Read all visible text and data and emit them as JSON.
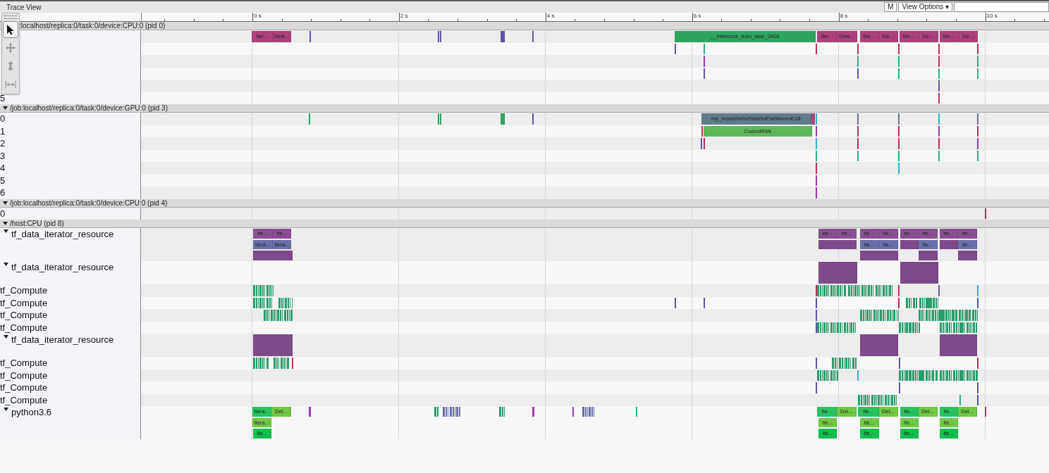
{
  "window": {
    "title": "Trace View"
  },
  "header_buttons": [
    {
      "label": "M"
    },
    {
      "label": "View Options ▾"
    }
  ],
  "tools": [
    {
      "kind": "select",
      "selected": true
    },
    {
      "kind": "pan",
      "selected": false
    },
    {
      "kind": "zoom",
      "selected": false
    },
    {
      "kind": "timing",
      "selected": false
    }
  ],
  "ruler": {
    "ticks": [
      {
        "label": "0 s"
      },
      {
        "label": "2 s"
      },
      {
        "label": "4 s"
      },
      {
        "label": "6 s"
      },
      {
        "label": "8 s"
      },
      {
        "label": "10 s"
      }
    ]
  },
  "processes": [
    {
      "title": ":localhost/replica:0/task:0/device:CPU:0 (pid 0)",
      "expanded": true,
      "under_toolbar": true,
      "threads": [
        {
          "kind": "plain",
          "lanes": [
            [
              {
                "kind": "slice",
                "color": "#ab4279",
                "label": "Iter..."
              },
              {
                "kind": "slice",
                "color": "#ab4279",
                "label": "Dele..."
              },
              {
                "kind": "tick",
                "color": "#5b57a8"
              },
              {
                "kind": "tick",
                "color": "#5b57a8"
              },
              {
                "kind": "tick",
                "color": "#5b57a8"
              },
              {
                "kind": "slice",
                "color": "#5b57a8"
              },
              {
                "kind": "tick",
                "color": "#5b57a8"
              },
              {
                "kind": "slice",
                "color": "#2ea55e",
                "label": "__inference_train_step_3406"
              },
              {
                "kind": "slice",
                "color": "#ab4279",
                "label": "Iter..."
              },
              {
                "kind": "slice",
                "color": "#ab4279",
                "label": "Dele..."
              },
              {
                "kind": "slice",
                "color": "#ab4279",
                "label": "Iter..."
              },
              {
                "kind": "slice",
                "color": "#ab4279",
                "label": "De..."
              },
              {
                "kind": "slice",
                "color": "#ab4279",
                "label": "Iter..."
              },
              {
                "kind": "slice",
                "color": "#ab4279",
                "label": "De..."
              },
              {
                "kind": "slice",
                "color": "#ab4279",
                "label": "Iter..."
              },
              {
                "kind": "slice",
                "color": "#ab4279",
                "label": "De..."
              }
            ]
          ]
        },
        {
          "kind": "plain",
          "lanes": [
            [
              {
                "kind": "tick",
                "color": "#5b57a8"
              },
              {
                "kind": "tick",
                "color": "#2bb28a"
              },
              {
                "kind": "tick",
                "color": "#c0305a"
              },
              {
                "kind": "tick",
                "color": "#c0305a"
              },
              {
                "kind": "tick",
                "color": "#c0305a"
              },
              {
                "kind": "tick",
                "color": "#c0305a"
              },
              {
                "kind": "tick",
                "color": "#c0305a"
              }
            ]
          ]
        },
        {
          "kind": "plain",
          "lanes": [
            [
              {
                "kind": "tick",
                "color": "#9b3cb0"
              },
              {
                "kind": "tick",
                "color": "#2bb28a"
              },
              {
                "kind": "tick",
                "color": "#2bb28a"
              },
              {
                "kind": "tick",
                "color": "#c0305a"
              },
              {
                "kind": "tick",
                "color": "#2bb28a"
              }
            ]
          ]
        },
        {
          "kind": "plain",
          "lanes": [
            [
              {
                "kind": "tick",
                "color": "#5b57a8"
              },
              {
                "kind": "tick",
                "color": "#5b57a8"
              },
              {
                "kind": "tick",
                "color": "#2bb28a"
              },
              {
                "kind": "tick",
                "color": "#2bb28a"
              },
              {
                "kind": "tick",
                "color": "#2bb28a"
              }
            ]
          ]
        },
        {
          "kind": "plain",
          "lanes": [
            [
              {
                "kind": "tick",
                "color": "#5b57a8"
              }
            ]
          ]
        },
        {
          "kind": "plain",
          "label": "5",
          "lanes": [
            [
              {
                "kind": "tick",
                "color": "#c0305a"
              }
            ]
          ]
        }
      ]
    },
    {
      "title": "/job:localhost/replica:0/task:0/device:GPU:0 (pid 3)",
      "expanded": true,
      "under_toolbar": false,
      "threads": [
        {
          "kind": "plain",
          "label": "0",
          "lanes": [
            [
              {
                "kind": "tick",
                "color": "#2ea55e"
              },
              {
                "kind": "tick",
                "color": "#2ea55e"
              },
              {
                "kind": "tick",
                "color": "#2ea55e"
              },
              {
                "kind": "slice",
                "color": "#2ea55e"
              },
              {
                "kind": "tick",
                "color": "#5b57a8"
              },
              {
                "kind": "slice",
                "color": "#5f7c8c",
                "label": "my_model/lstm/StatefulPartitionedCall"
              },
              {
                "kind": "slice",
                "color": "#ab4279"
              },
              {
                "kind": "tick",
                "color": "#2cb5c8"
              },
              {
                "kind": "tick",
                "color": "#5f7c8c"
              },
              {
                "kind": "tick",
                "color": "#5f7c8c"
              },
              {
                "kind": "tick",
                "color": "#2cb5c8"
              },
              {
                "kind": "tick",
                "color": "#5f7c8c"
              }
            ]
          ]
        },
        {
          "kind": "plain",
          "label": "1",
          "lanes": [
            [
              {
                "kind": "tick",
                "color": "#c0305a"
              },
              {
                "kind": "slice",
                "color": "#5db85a",
                "label": "CudnnRNN"
              },
              {
                "kind": "tick",
                "color": "#9b3cb0"
              },
              {
                "kind": "tick",
                "color": "#c0305a"
              },
              {
                "kind": "tick",
                "color": "#c0305a"
              },
              {
                "kind": "tick",
                "color": "#9b3cb0"
              },
              {
                "kind": "tick",
                "color": "#c0305a"
              }
            ]
          ]
        },
        {
          "kind": "plain",
          "label": "2",
          "lanes": [
            [
              {
                "kind": "tick",
                "color": "#5b57a8"
              },
              {
                "kind": "tick",
                "color": "#c0305a"
              },
              {
                "kind": "tick",
                "color": "#2cb5c8"
              },
              {
                "kind": "tick",
                "color": "#c0305a"
              },
              {
                "kind": "tick",
                "color": "#c0305a"
              },
              {
                "kind": "tick",
                "color": "#c0305a"
              },
              {
                "kind": "tick",
                "color": "#9b3cb0"
              }
            ]
          ]
        },
        {
          "kind": "plain",
          "label": "3",
          "lanes": [
            [
              {
                "kind": "tick",
                "color": "#2bb28a"
              },
              {
                "kind": "tick",
                "color": "#2bb28a"
              },
              {
                "kind": "tick",
                "color": "#2bb28a"
              },
              {
                "kind": "tick",
                "color": "#2bb28a"
              },
              {
                "kind": "tick",
                "color": "#2bb28a"
              }
            ]
          ]
        },
        {
          "kind": "plain",
          "label": "4",
          "lanes": [
            [
              {
                "kind": "tick",
                "color": "#c0305a"
              },
              {
                "kind": "tick",
                "color": "#2cb5c8"
              }
            ]
          ]
        },
        {
          "kind": "plain",
          "label": "5",
          "lanes": [
            [
              {
                "kind": "tick",
                "color": "#9b3cb0"
              }
            ]
          ]
        },
        {
          "kind": "plain",
          "label": "6",
          "lanes": [
            [
              {
                "kind": "tick",
                "color": "#9b3cb0"
              }
            ]
          ]
        }
      ]
    },
    {
      "title": "/job:localhost/replica:0/task:0/device:CPU:0 (pid 4)",
      "expanded": true,
      "under_toolbar": false,
      "threads": [
        {
          "kind": "plain",
          "label": "0",
          "lanes": [
            [
              {
                "kind": "tick",
                "color": "#c0305a"
              }
            ]
          ]
        }
      ]
    },
    {
      "title": "/host:CPU (pid 8)",
      "expanded": true,
      "under_toolbar": false,
      "threads": [
        {
          "kind": "group",
          "expanded": true,
          "label": "tf_data_iterator_resource",
          "lanes": [
            [
              {
                "kind": "slice",
                "color": "#8a4f92",
                "label": "Ite..."
              },
              {
                "kind": "slice",
                "color": "#8a4f92",
                "label": "Ite..."
              },
              {
                "kind": "slice",
                "color": "#8a4f92",
                "label": "Ite..."
              },
              {
                "kind": "slice",
                "color": "#8a4f92",
                "label": "Ite..."
              },
              {
                "kind": "slice",
                "color": "#8a4f92",
                "label": "Ite..."
              },
              {
                "kind": "slice",
                "color": "#8a4f92",
                "label": "Ite..."
              },
              {
                "kind": "slice",
                "color": "#8a4f92",
                "label": "Ite..."
              },
              {
                "kind": "slice",
                "color": "#8a4f92",
                "label": "Ite..."
              },
              {
                "kind": "slice",
                "color": "#8a4f92",
                "label": "Ite..."
              },
              {
                "kind": "slice",
                "color": "#8a4f92",
                "label": "Ite..."
              }
            ],
            [
              {
                "kind": "slice",
                "color": "#6b6ea8",
                "label": "Itera..."
              },
              {
                "kind": "slice",
                "color": "#6b6ea8",
                "label": "Itera..."
              },
              {
                "kind": "slice",
                "color": "#7e4a8a"
              },
              {
                "kind": "slice",
                "color": "#6b6ea8",
                "label": "Ite..."
              },
              {
                "kind": "slice",
                "color": "#6b6ea8",
                "label": "Ite..."
              },
              {
                "kind": "slice",
                "color": "#7e4a8a"
              },
              {
                "kind": "slice",
                "color": "#6b6ea8",
                "label": "Ite..."
              },
              {
                "kind": "slice",
                "color": "#7e4a8a"
              },
              {
                "kind": "slice",
                "color": "#6b6ea8",
                "label": "Ite..."
              }
            ],
            [
              {
                "kind": "slice",
                "color": "#7e4a8a"
              },
              {
                "kind": "slice",
                "color": "#7e4a8a"
              },
              {
                "kind": "slice",
                "color": "#7e4a8a"
              },
              {
                "kind": "slice",
                "color": "#7e4a8a"
              }
            ]
          ]
        },
        {
          "kind": "group",
          "expanded": true,
          "label": "tf_data_iterator_resource",
          "lanes": [
            [
              {
                "kind": "deep",
                "color": "#7e4a8a"
              },
              {
                "kind": "deep",
                "color": "#7e4a8a"
              }
            ]
          ]
        },
        {
          "kind": "plain",
          "label": "tf_Compute",
          "lanes": [
            [
              {
                "kind": "burst",
                "color": "#2a9d6c"
              },
              {
                "kind": "tick",
                "color": "#c0305a"
              },
              {
                "kind": "burst",
                "color": "#2a9d6c"
              },
              {
                "kind": "burst",
                "color": "#2a9d6c"
              },
              {
                "kind": "burst",
                "color": "#2a9d6c"
              },
              {
                "kind": "tick",
                "color": "#c0305a"
              },
              {
                "kind": "tick",
                "color": "#5b57a8"
              },
              {
                "kind": "tick",
                "color": "#2cb5c8"
              }
            ]
          ]
        },
        {
          "kind": "plain",
          "label": "tf_Compute",
          "lanes": [
            [
              {
                "kind": "burst",
                "color": "#2a9d6c"
              },
              {
                "kind": "burst",
                "color": "#2a9d6c"
              },
              {
                "kind": "tick",
                "color": "#5b57a8"
              },
              {
                "kind": "tick",
                "color": "#5b57a8"
              },
              {
                "kind": "tick",
                "color": "#5b57a8"
              },
              {
                "kind": "tick",
                "color": "#c0305a"
              },
              {
                "kind": "burst",
                "color": "#2a9d6c"
              },
              {
                "kind": "tick",
                "color": "#5b57a8"
              }
            ]
          ]
        },
        {
          "kind": "plain",
          "label": "tf_Compute",
          "lanes": [
            [
              {
                "kind": "burst",
                "color": "#2a9d6c"
              },
              {
                "kind": "tick",
                "color": "#5b57a8"
              },
              {
                "kind": "burst",
                "color": "#2a9d6c"
              },
              {
                "kind": "burst",
                "color": "#2a9d6c"
              }
            ]
          ]
        },
        {
          "kind": "plain",
          "label": "tf_Compute",
          "lanes": [
            [
              {
                "kind": "tick",
                "color": "#5b57a8"
              },
              {
                "kind": "burst",
                "color": "#2a9d6c"
              },
              {
                "kind": "burst",
                "color": "#2a9d6c"
              },
              {
                "kind": "burst",
                "color": "#2a9d6c"
              }
            ]
          ]
        },
        {
          "kind": "group",
          "expanded": true,
          "label": "tf_data_iterator_resource",
          "lanes": [
            [
              {
                "kind": "deep",
                "color": "#7e4a8a"
              },
              {
                "kind": "deep",
                "color": "#7e4a8a"
              },
              {
                "kind": "deep",
                "color": "#7e4a8a"
              }
            ]
          ]
        },
        {
          "kind": "plain",
          "label": "tf_Compute",
          "lanes": [
            [
              {
                "kind": "burst",
                "color": "#2a9d6c"
              },
              {
                "kind": "burst",
                "color": "#2a9d6c"
              },
              {
                "kind": "tick",
                "color": "#c0305a"
              },
              {
                "kind": "tick",
                "color": "#5b57a8"
              },
              {
                "kind": "burst",
                "color": "#2a9d6c"
              },
              {
                "kind": "tick",
                "color": "#5b57a8"
              },
              {
                "kind": "tick",
                "color": "#c0305a"
              }
            ]
          ]
        },
        {
          "kind": "plain",
          "label": "tf_Compute",
          "lanes": [
            [
              {
                "kind": "burst",
                "color": "#2a9d6c"
              },
              {
                "kind": "tick",
                "color": "#2cb5c8"
              },
              {
                "kind": "burst",
                "color": "#2a9d6c"
              },
              {
                "kind": "burst",
                "color": "#2a9d6c"
              }
            ]
          ]
        },
        {
          "kind": "plain",
          "label": "tf_Compute",
          "lanes": [
            [
              {
                "kind": "tick",
                "color": "#5b57a8"
              },
              {
                "kind": "tick",
                "color": "#5b57a8"
              },
              {
                "kind": "tick",
                "color": "#5b57a8"
              }
            ]
          ]
        },
        {
          "kind": "plain",
          "label": "tf_Compute",
          "lanes": [
            [
              {
                "kind": "burst",
                "color": "#2a9d6c"
              },
              {
                "kind": "tick",
                "color": "#2bb28a"
              },
              {
                "kind": "tick",
                "color": "#5b57a8"
              }
            ]
          ]
        },
        {
          "kind": "group",
          "expanded": true,
          "label": "python3.6",
          "lanes": [
            [
              {
                "kind": "slice",
                "color": "#27c460",
                "label": "Itera..."
              },
              {
                "kind": "slice",
                "color": "#70c844",
                "label": "Del..."
              },
              {
                "kind": "burst",
                "color": "#9b3cb0"
              },
              {
                "kind": "burst",
                "color": "#2a9d6c"
              },
              {
                "kind": "burst",
                "color": "#6b6ea8"
              },
              {
                "kind": "burst",
                "color": "#2a9d6c"
              },
              {
                "kind": "burst",
                "color": "#9b3cb0"
              },
              {
                "kind": "tick",
                "color": "#9b3cb0"
              },
              {
                "kind": "burst",
                "color": "#6b6ea8"
              },
              {
                "kind": "tick",
                "color": "#2bb28a"
              },
              {
                "kind": "slice",
                "color": "#27c460",
                "label": "Ite..."
              },
              {
                "kind": "slice",
                "color": "#70c844",
                "label": "Del..."
              },
              {
                "kind": "slice",
                "color": "#27c460",
                "label": "Ite..."
              },
              {
                "kind": "slice",
                "color": "#70c844",
                "label": "Del..."
              },
              {
                "kind": "slice",
                "color": "#27c460",
                "label": "Ite..."
              },
              {
                "kind": "slice",
                "color": "#70c844",
                "label": "Del..."
              },
              {
                "kind": "slice",
                "color": "#27c460",
                "label": "Ite..."
              },
              {
                "kind": "slice",
                "color": "#70c844",
                "label": "Del..."
              },
              {
                "kind": "tick",
                "color": "#c0305a"
              }
            ],
            [
              {
                "kind": "slice",
                "color": "#70c844",
                "label": "Itera..."
              },
              {
                "kind": "slice",
                "color": "#70c844",
                "label": "Ite..."
              },
              {
                "kind": "slice",
                "color": "#70c844",
                "label": "Ite..."
              },
              {
                "kind": "slice",
                "color": "#70c844",
                "label": "Ite..."
              },
              {
                "kind": "slice",
                "color": "#70c844",
                "label": "Ite..."
              }
            ],
            [
              {
                "kind": "slice",
                "color": "#12bf4f",
                "label": "Ite..."
              },
              {
                "kind": "slice",
                "color": "#12bf4f",
                "label": "Ite..."
              },
              {
                "kind": "slice",
                "color": "#12bf4f",
                "label": "Ite..."
              },
              {
                "kind": "slice",
                "color": "#12bf4f",
                "label": "Ite..."
              },
              {
                "kind": "slice",
                "color": "#12bf4f",
                "label": "Ite..."
              }
            ]
          ]
        }
      ]
    }
  ]
}
